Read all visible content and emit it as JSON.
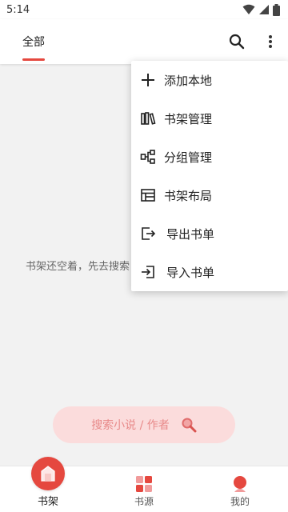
{
  "status_bar": {
    "time": "5:14"
  },
  "top_bar": {
    "tab_label": "全部",
    "search_icon": "search-icon",
    "more_icon": "more-vert-icon"
  },
  "shelf": {
    "empty_message": "书架还空着，先去搜索",
    "search_placeholder": "搜索小说 / 作者"
  },
  "overflow_menu": {
    "items": [
      {
        "label": "添加本地",
        "icon": "add-icon"
      },
      {
        "label": "书架管理",
        "icon": "books-icon"
      },
      {
        "label": "分组管理",
        "icon": "group-icon"
      },
      {
        "label": "书架布局",
        "icon": "layout-icon"
      },
      {
        "label": "导出书单",
        "icon": "export-icon"
      },
      {
        "label": "导入书单",
        "icon": "import-icon"
      }
    ]
  },
  "bottom_nav": {
    "items": [
      {
        "label": "书架",
        "icon": "bookshelf-icon",
        "active": true
      },
      {
        "label": "书源",
        "icon": "source-icon",
        "active": false
      },
      {
        "label": "我的",
        "icon": "profile-icon",
        "active": false
      }
    ]
  },
  "colors": {
    "accent": "#e5483f",
    "pill_bg": "#fbdcdc",
    "pill_text": "#e88a8a"
  }
}
